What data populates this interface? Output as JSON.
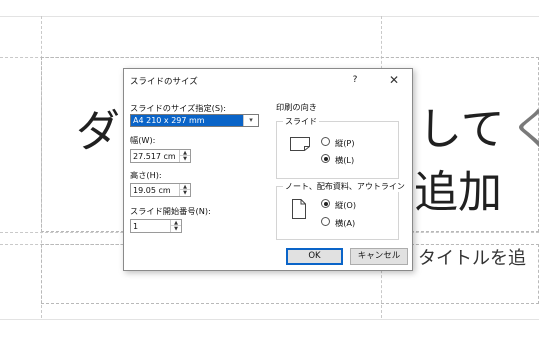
{
  "slide": {
    "title_left": "ダ",
    "title_right_1": "して",
    "title_right_1b": "く",
    "title_right_2": "追加",
    "subtitle": "タイトルを追"
  },
  "dialog": {
    "title": "スライドのサイズ",
    "help": "?",
    "close": "✕",
    "size_label": "スライドのサイズ指定(S):",
    "size_value": "A4 210 x 297 mm",
    "width_label": "幅(W):",
    "width_value": "27.517 cm",
    "height_label": "高さ(H):",
    "height_value": "19.05 cm",
    "start_label": "スライド開始番号(N):",
    "start_value": "1",
    "orientation_title": "印刷の向き",
    "slide_group": "スライド",
    "slide_portrait": "縦(P)",
    "slide_landscape": "横(L)",
    "slide_selected": "landscape",
    "notes_group": "ノート、配布資料、アウトライン",
    "notes_portrait": "縦(O)",
    "notes_landscape": "横(A)",
    "notes_selected": "portrait",
    "ok": "OK",
    "cancel": "キャンセル"
  },
  "icons": {
    "combo_arrow": "▾",
    "spin_up": "▲",
    "spin_down": "▼"
  },
  "colors": {
    "accent": "#0a64c8"
  }
}
